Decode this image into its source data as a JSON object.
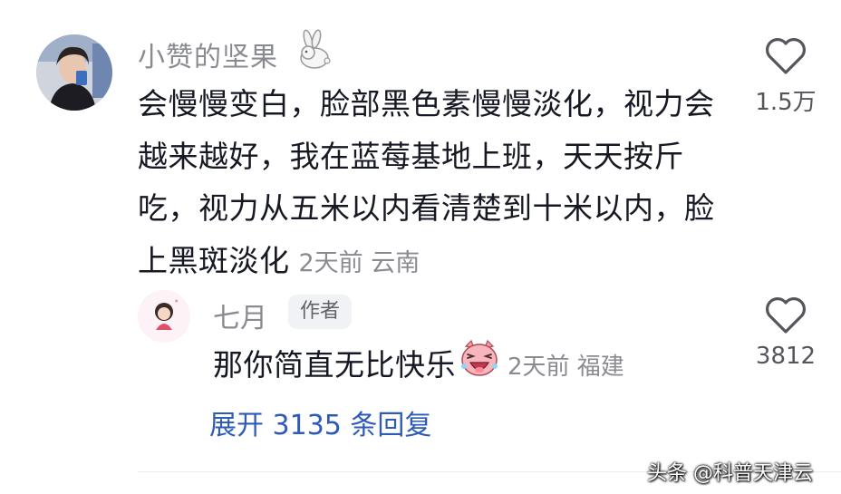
{
  "comment": {
    "username": "小赞的坚果",
    "username_emoji": "rabbit-emoji",
    "text": "会慢慢变白，脸部黑色素慢慢淡化，视力会越来越好，我在蓝莓基地上班，天天按斤吃，视力从五米以内看清楚到十米以内，脸上黑斑淡化",
    "meta": "2天前 云南",
    "like_count": "1.5万"
  },
  "reply": {
    "username": "七月",
    "badge": "作者",
    "text": "那你简直无比快乐",
    "emoji": "laughing-pig-emoji",
    "meta": "2天前 福建",
    "like_count": "3812"
  },
  "expand_replies_label": "展开 3135 条回复",
  "watermark": "头条 @科普天津云",
  "colors": {
    "primary_text": "#161823",
    "secondary_text": "#8a8b91",
    "link": "#2e5ab8",
    "badge_bg": "#f1f2f5"
  }
}
